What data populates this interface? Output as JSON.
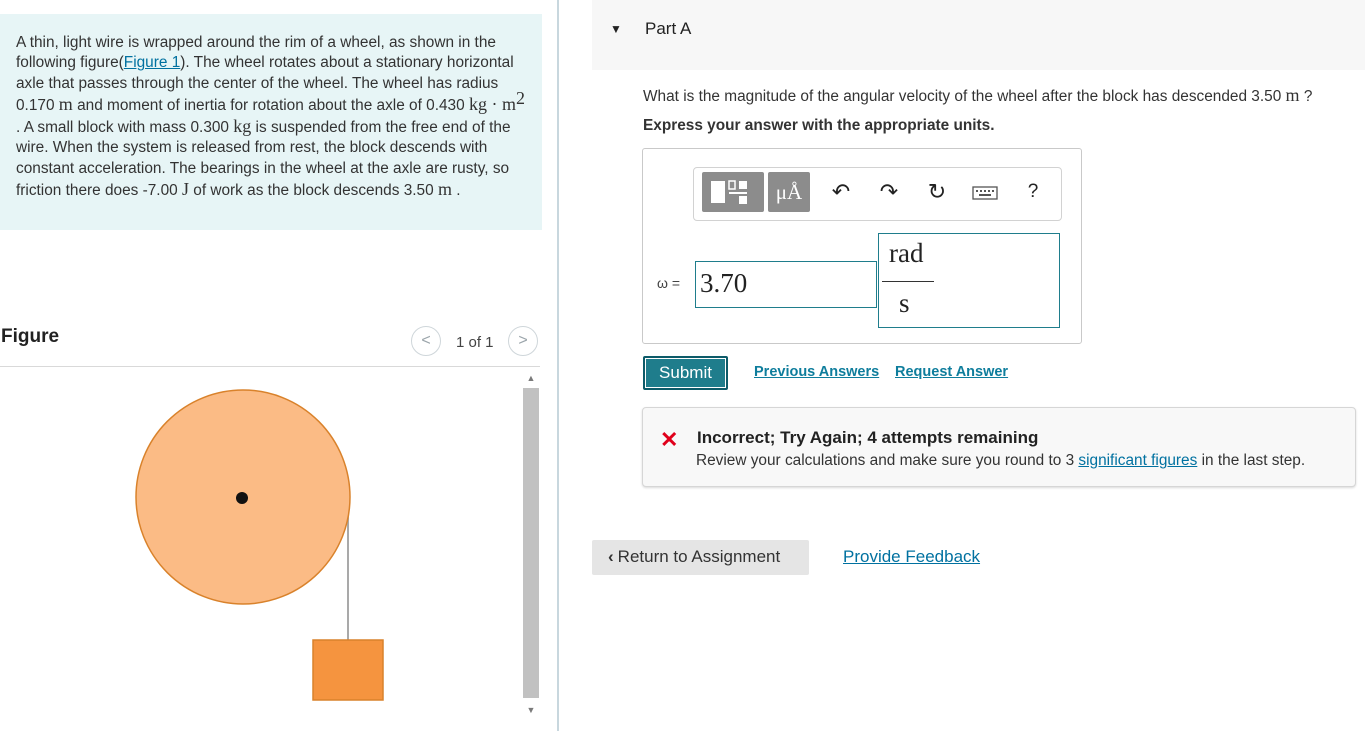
{
  "problem": {
    "part1": "A thin, light wire is wrapped around the rim of a wheel, as shown in the following figure(",
    "figure_link": "Figure 1",
    "part2": "). The wheel rotates about a stationary horizontal axle that passes through the center of the wheel. The wheel has radius 0.170 ",
    "unit_m": "m",
    "part3": " and moment of inertia for rotation about the axle of 0.430 ",
    "unit_kgm": "kg · m",
    "sup2": "2",
    "part4": " . A small block with mass 0.300 ",
    "unit_kg": "kg",
    "part5": " is suspended from the free end of the wire. When the system is released from rest, the block descends with constant acceleration. The bearings in the wheel at the axle are rusty, so friction there does -7.00 ",
    "unit_J": "J",
    "part6": " of work as the block descends 3.50 ",
    "unit_m2": "m",
    "part7": " ."
  },
  "figure": {
    "label": "Figure",
    "prev": "<",
    "next": ">",
    "pager": "1 of 1",
    "wheel_color": "#fbbb85",
    "wheel_stroke": "#d9822b",
    "block_color": "#f5943f"
  },
  "part": {
    "caret": "▼",
    "title": "Part A",
    "question_before": "What is the magnitude of the angular velocity of the wheel after the block has descended 3.50 ",
    "question_unit": "m",
    "question_after": " ?",
    "instructions": "Express your answer with the appropriate units."
  },
  "toolbar": {
    "mu_label": "μÅ",
    "undo_icon": "↶",
    "redo_icon": "↷",
    "reset_icon": "↻",
    "help_label": "?"
  },
  "answer": {
    "variable": "ω =",
    "value": "3.70",
    "unit_numerator": "rad",
    "unit_denominator": "s"
  },
  "actions": {
    "submit": "Submit",
    "previous_answers": "Previous Answers",
    "request_answer": "Request Answer"
  },
  "feedback": {
    "icon": "✕",
    "title": "Incorrect; Try Again; 4 attempts remaining",
    "body_before": "Review your calculations and make sure you round to 3 ",
    "body_link": "significant figures",
    "body_after": " in the last step."
  },
  "footer": {
    "return_chevron": "‹",
    "return_label": "Return to Assignment",
    "provide_feedback": "Provide Feedback"
  }
}
